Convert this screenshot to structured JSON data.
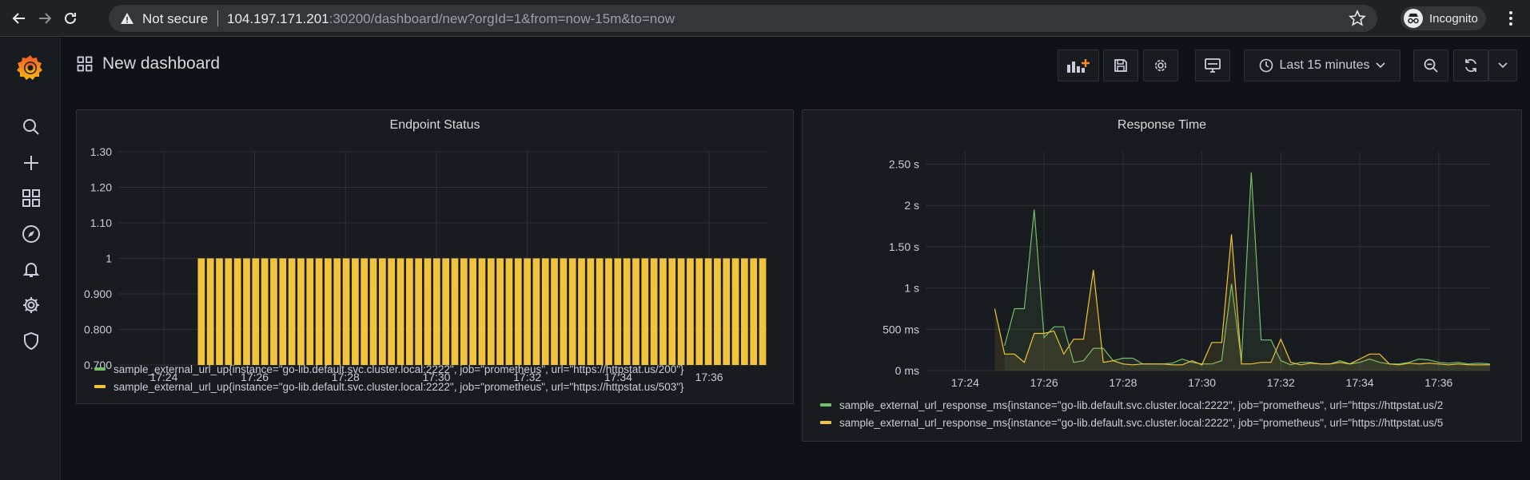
{
  "browser": {
    "security_label": "Not secure",
    "url_host": "104.197.171.201",
    "url_rest": ":30200/dashboard/new?orgId=1&from=now-15m&to=now",
    "profile_label": "Incognito"
  },
  "dashboard": {
    "title": "New dashboard",
    "time_range_label": "Last 15 minutes"
  },
  "colors": {
    "green": "#73bf69",
    "yellow": "#f2c33c",
    "grid": "#2c3235",
    "axis_text": "#ccccdc"
  },
  "panels": {
    "endpoint_status": {
      "title": "Endpoint Status",
      "legend": [
        {
          "label": "sample_external_url_up{instance=\"go-lib.default.svc.cluster.local:2222\", job=\"prometheus\", url=\"https://httpstat.us/200\"}",
          "color": "#73bf69"
        },
        {
          "label": "sample_external_url_up{instance=\"go-lib.default.svc.cluster.local:2222\", job=\"prometheus\", url=\"https://httpstat.us/503\"}",
          "color": "#f2c33c"
        }
      ]
    },
    "response_time": {
      "title": "Response Time",
      "legend": [
        {
          "label": "sample_external_url_response_ms{instance=\"go-lib.default.svc.cluster.local:2222\", job=\"prometheus\", url=\"https://httpstat.us/2",
          "color": "#73bf69"
        },
        {
          "label": "sample_external_url_response_ms{instance=\"go-lib.default.svc.cluster.local:2222\", job=\"prometheus\", url=\"https://httpstat.us/5",
          "color": "#f2c33c"
        }
      ]
    }
  },
  "chart_data": [
    {
      "type": "bar",
      "title": "Endpoint Status",
      "x_ticks": [
        "17:24",
        "17:26",
        "17:28",
        "17:30",
        "17:32",
        "17:34",
        "17:36"
      ],
      "y_ticks": [
        "0.700",
        "0.800",
        "0.900",
        "1",
        "1.10",
        "1.20",
        "1.30"
      ],
      "ylim": [
        0.7,
        1.3
      ],
      "xlim_minutes": [
        23.0,
        37.3
      ],
      "bars": {
        "start_minute": 24.75,
        "end_minute": 37.3,
        "count": 63,
        "value": 1
      }
    },
    {
      "type": "line",
      "title": "Response Time",
      "x_ticks": [
        "17:24",
        "17:26",
        "17:28",
        "17:30",
        "17:32",
        "17:34",
        "17:36"
      ],
      "y_ticks": [
        "0 ms",
        "500 ms",
        "1 s",
        "1.50 s",
        "2 s",
        "2.50 s"
      ],
      "ylim": [
        0,
        2.65
      ],
      "xlim_minutes": [
        23.0,
        37.3
      ],
      "series": [
        {
          "color": "#73bf69",
          "x": [
            25.0,
            25.25,
            25.5,
            25.75,
            26.0,
            26.25,
            26.5,
            26.75,
            27.0,
            27.25,
            27.5,
            27.75,
            28.0,
            28.25,
            28.5,
            28.75,
            29.0,
            29.25,
            29.5,
            29.75,
            30.0,
            30.25,
            30.5,
            30.75,
            31.0,
            31.25,
            31.5,
            31.75,
            32.0,
            32.25,
            32.5,
            32.75,
            33.0,
            33.25,
            33.5,
            33.75,
            34.0,
            34.25,
            34.5,
            34.75,
            35.0,
            35.25,
            35.5,
            35.75,
            36.0,
            36.25,
            36.5,
            36.75,
            37.0,
            37.3
          ],
          "y": [
            0.3,
            0.75,
            0.75,
            1.95,
            0.4,
            0.53,
            0.53,
            0.1,
            0.12,
            0.27,
            0.27,
            0.12,
            0.15,
            0.15,
            0.08,
            0.08,
            0.08,
            0.09,
            0.14,
            0.1,
            0.08,
            0.08,
            0.12,
            1.05,
            0.12,
            2.4,
            0.37,
            0.37,
            0.12,
            0.07,
            0.1,
            0.1,
            0.08,
            0.08,
            0.12,
            0.08,
            0.1,
            0.14,
            0.1,
            0.08,
            0.08,
            0.1,
            0.14,
            0.13,
            0.1,
            0.09,
            0.1,
            0.08,
            0.09,
            0.08
          ]
        },
        {
          "color": "#f2c33c",
          "x": [
            24.75,
            25.0,
            25.25,
            25.5,
            25.75,
            26.0,
            26.25,
            26.5,
            26.75,
            27.0,
            27.25,
            27.5,
            27.75,
            28.0,
            28.25,
            28.5,
            28.75,
            29.0,
            29.25,
            29.5,
            29.75,
            30.0,
            30.25,
            30.5,
            30.75,
            31.0,
            31.25,
            31.5,
            31.75,
            32.0,
            32.25,
            32.5,
            32.75,
            33.0,
            33.25,
            33.5,
            33.75,
            34.0,
            34.25,
            34.5,
            34.75,
            35.0,
            35.25,
            35.5,
            35.75,
            36.0,
            36.25,
            36.5,
            36.75,
            37.0,
            37.3
          ],
          "y": [
            0.75,
            0.2,
            0.2,
            0.1,
            0.45,
            0.45,
            0.48,
            0.2,
            0.38,
            0.38,
            1.22,
            0.1,
            0.12,
            0.08,
            0.07,
            0.08,
            0.08,
            0.08,
            0.07,
            0.07,
            0.12,
            0.07,
            0.34,
            0.34,
            1.65,
            0.08,
            0.08,
            0.1,
            0.1,
            0.38,
            0.1,
            0.07,
            0.09,
            0.08,
            0.08,
            0.1,
            0.08,
            0.14,
            0.2,
            0.2,
            0.08,
            0.07,
            0.09,
            0.08,
            0.09,
            0.08,
            0.07,
            0.08,
            0.07,
            0.07,
            0.07
          ]
        }
      ]
    }
  ]
}
